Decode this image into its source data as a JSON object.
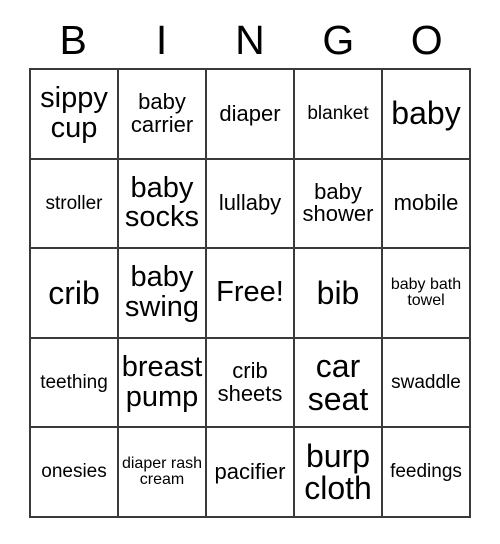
{
  "card": {
    "headers": [
      "B",
      "I",
      "N",
      "G",
      "O"
    ],
    "rows": [
      [
        {
          "text": "sippy cup",
          "size": "xl"
        },
        {
          "text": "baby carrier",
          "size": "md"
        },
        {
          "text": "diaper",
          "size": "md"
        },
        {
          "text": "blanket",
          "size": "sm"
        },
        {
          "text": "baby",
          "size": "xxl"
        }
      ],
      [
        {
          "text": "stroller",
          "size": "sm"
        },
        {
          "text": "baby socks",
          "size": "xl"
        },
        {
          "text": "lullaby",
          "size": "md"
        },
        {
          "text": "baby shower",
          "size": "md"
        },
        {
          "text": "mobile",
          "size": "md"
        }
      ],
      [
        {
          "text": "crib",
          "size": "xxl"
        },
        {
          "text": "baby swing",
          "size": "xl"
        },
        {
          "text": "Free!",
          "size": "xl"
        },
        {
          "text": "bib",
          "size": "xxl"
        },
        {
          "text": "baby bath towel",
          "size": "xs"
        }
      ],
      [
        {
          "text": "teething",
          "size": "sm"
        },
        {
          "text": "breast pump",
          "size": "xl"
        },
        {
          "text": "crib sheets",
          "size": "md"
        },
        {
          "text": "car seat",
          "size": "xxl"
        },
        {
          "text": "swaddle",
          "size": "sm"
        }
      ],
      [
        {
          "text": "onesies",
          "size": "sm"
        },
        {
          "text": "diaper rash cream",
          "size": "xs"
        },
        {
          "text": "pacifier",
          "size": "md"
        },
        {
          "text": "burp cloth",
          "size": "xxl"
        },
        {
          "text": "feedings",
          "size": "sm"
        }
      ]
    ]
  }
}
